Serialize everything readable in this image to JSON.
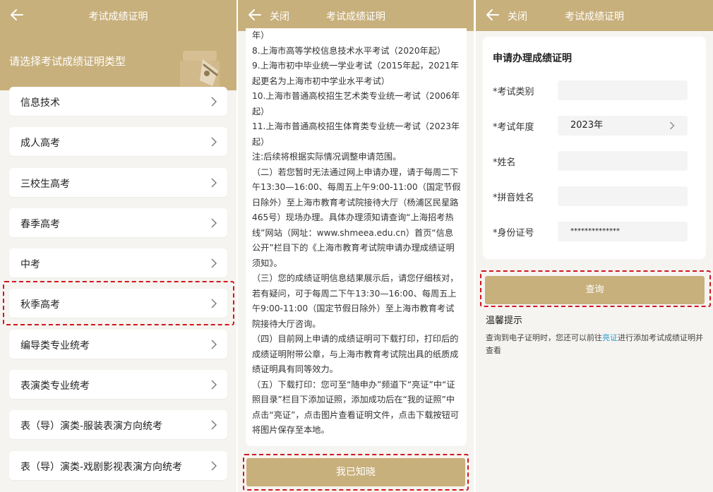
{
  "panel1": {
    "title": "考试成绩证明",
    "prompt": "请选择考试成绩证明类型",
    "items": [
      {
        "label": "信息技术"
      },
      {
        "label": "成人高考"
      },
      {
        "label": "三校生高考"
      },
      {
        "label": "春季高考"
      },
      {
        "label": "中考"
      },
      {
        "label": "秋季高考"
      },
      {
        "label": "编导类专业统考"
      },
      {
        "label": "表演类专业统考"
      },
      {
        "label": "表（导）演类-服装表演方向统考"
      },
      {
        "label": "表（导）演类-戏剧影视表演方向统考"
      }
    ]
  },
  "panel2": {
    "close_label": "关闭",
    "title": "考试成绩证明",
    "paragraphs": [
      "年）",
      "8.上海市高等学校信息技术水平考试（2020年起）",
      "9.上海市初中毕业统一学业考试（2015年起，2021年起更名为上海市初中学业水平考试）",
      "10.上海市普通高校招生艺术类专业统一考试（2006年起）",
      "11.上海市普通高校招生体育类专业统一考试（2023年起）",
      "注:后续将根据实际情况调整申请范围。",
      "（二）若您暂时无法通过网上申请办理，请于每周二下午13:30—16:00、每周五上午9:00-11:00（国定节假日除外）至上海市教育考试院接待大厅（杨浦区民星路465号）现场办理。具体办理须知请查询“上海招考热线”网站（网址：www.shmeea.edu.cn）首页“信息公开”栏目下的《上海市教育考试院申请办理成绩证明须知》。",
      "（三）您的成绩证明信息结果展示后，请您仔细核对，若有疑问，可于每周二下午13:30—16:00、每周五上午9:00-11:00（国定节假日除外）至上海市教育考试院接待大厅咨询。",
      "（四）目前网上申请的成绩证明可下载打印，打印后的成绩证明附带公章，与上海市教育考试院出具的纸质成绩证明具有同等效力。",
      "（五）下载打印：您可至“随申办”频道下“亮证”中“证照目录”栏目下添加证照，添加成功后在“我的证照”中点击“亮证”，点击图片查看证明文件，点击下载按钮可将图片保存至本地。"
    ],
    "ok_label": "我已知晓"
  },
  "panel3": {
    "close_label": "关闭",
    "title": "考试成绩证明",
    "card_title": "申请办理成绩证明",
    "fields": [
      {
        "label": "*考试类别",
        "value": ""
      },
      {
        "label": "*考试年度",
        "value": "2023年"
      },
      {
        "label": "*姓名",
        "value": ""
      },
      {
        "label": "*拼音姓名",
        "value": ""
      },
      {
        "label": "*身份证号",
        "value": "**************"
      }
    ],
    "query_label": "查询",
    "tips_title": "温馨提示",
    "tips_pre": "查询到电子证明时，您还可以前往",
    "tips_link": "亮证",
    "tips_post": "进行添加考试成绩证明并查看"
  },
  "colors": {
    "gold": "#c8b07c",
    "highlight": "#d0161e",
    "link": "#2f9fd8"
  }
}
